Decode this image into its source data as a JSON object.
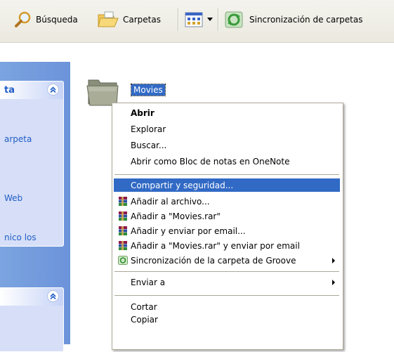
{
  "toolbar": {
    "search_label": "Búsqueda",
    "folders_label": "Carpetas",
    "sync_label": "Sincronización de carpetas"
  },
  "taskpane": {
    "panel1": {
      "title_fragment": "ta",
      "links": [
        "arpeta",
        "Web",
        "nico los"
      ]
    }
  },
  "folder": {
    "name": "Movies"
  },
  "context_menu": {
    "items": [
      {
        "label": "Abrir",
        "bold": true
      },
      {
        "label": "Explorar"
      },
      {
        "label": "Buscar..."
      },
      {
        "label": "Abrir como Bloc de notas en OneNote"
      },
      {
        "label": "Compartir y seguridad...",
        "highlighted": true
      },
      {
        "label": "Añadir al archivo...",
        "icon": "winrar-icon"
      },
      {
        "label": "Añadir a \"Movies.rar\"",
        "icon": "winrar-icon"
      },
      {
        "label": "Añadir y enviar por email...",
        "icon": "winrar-icon"
      },
      {
        "label": "Añadir a \"Movies.rar\" y enviar por email",
        "icon": "winrar-icon"
      },
      {
        "label": "Sincronización de la carpeta de Groove",
        "icon": "groove-icon",
        "submenu": true
      },
      {
        "label": "Enviar a",
        "submenu": true
      },
      {
        "label": "Cortar"
      },
      {
        "label": "Copiar"
      }
    ]
  },
  "colors": {
    "selection": "#316ac5",
    "taskpane_bg": "#7ba4e0",
    "link": "#215dc6"
  }
}
